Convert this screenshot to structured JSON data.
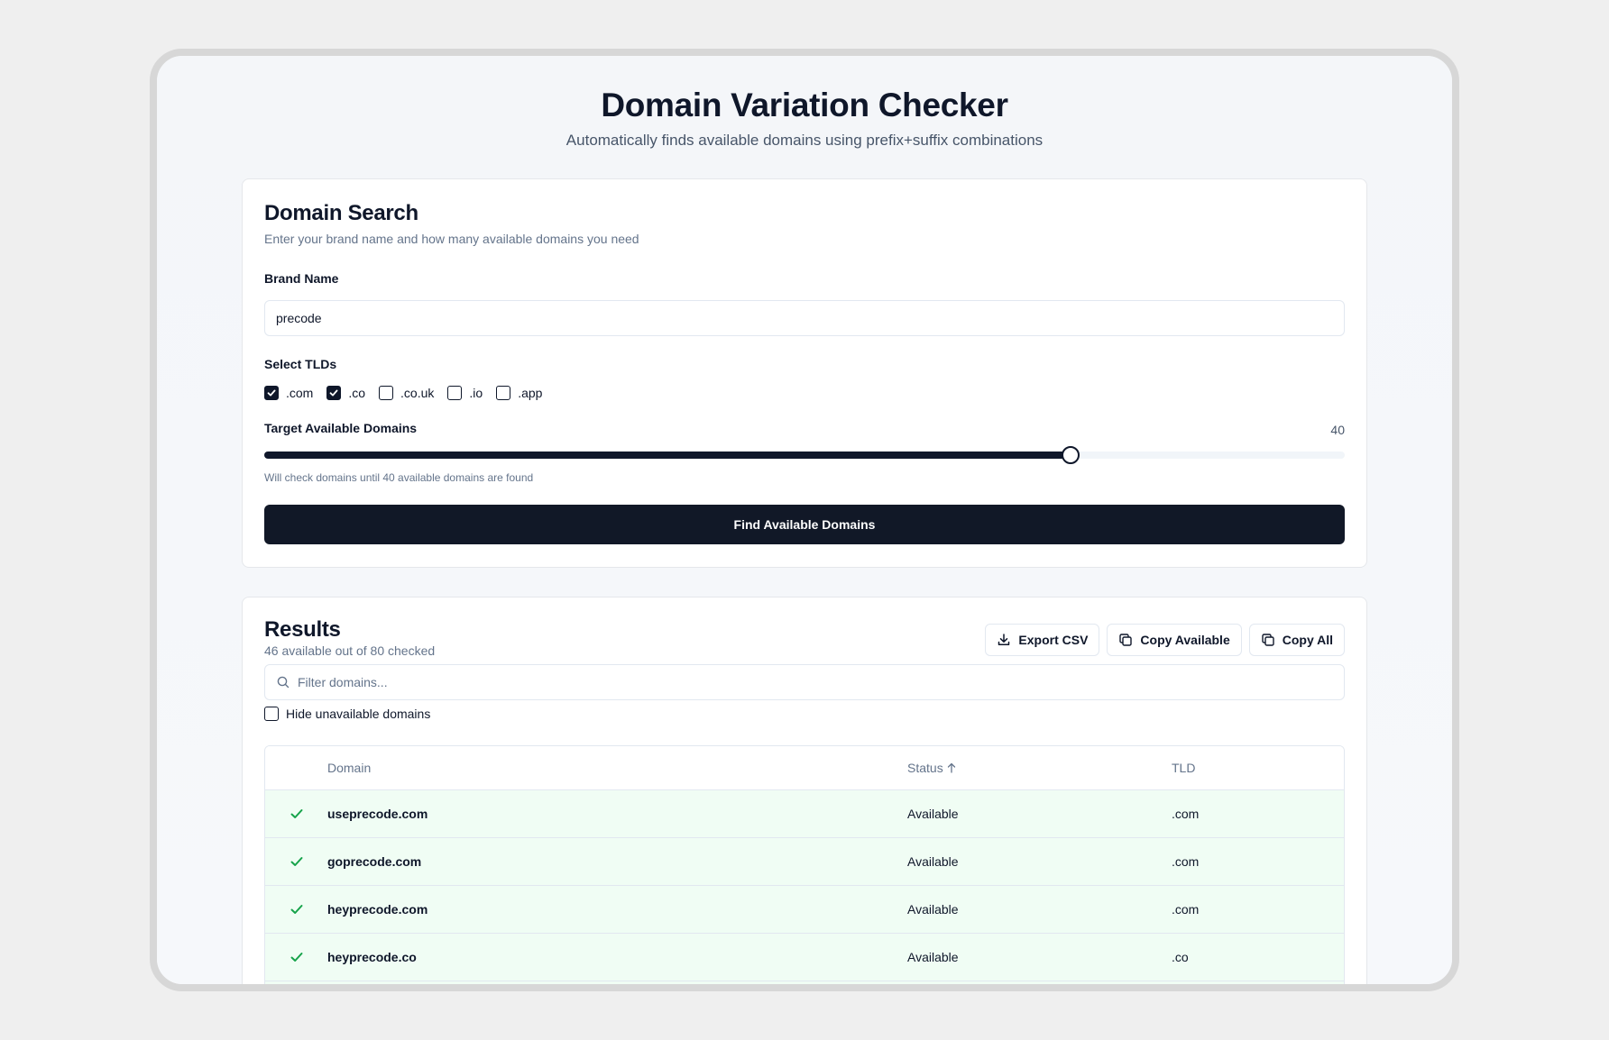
{
  "header": {
    "title": "Domain Variation Checker",
    "subtitle": "Automatically finds available domains using prefix+suffix combinations"
  },
  "search": {
    "title": "Domain Search",
    "description": "Enter your brand name and how many available domains you need",
    "brand_label": "Brand Name",
    "brand_value": "precode",
    "tlds_label": "Select TLDs",
    "tlds": [
      {
        "label": ".com",
        "checked": true
      },
      {
        "label": ".co",
        "checked": true
      },
      {
        "label": ".co.uk",
        "checked": false
      },
      {
        "label": ".io",
        "checked": false
      },
      {
        "label": ".app",
        "checked": false
      }
    ],
    "target_label": "Target Available Domains",
    "target_value": "40",
    "target_fraction": 0.746,
    "hint": "Will check domains until 40 available domains are found",
    "submit_label": "Find Available Domains"
  },
  "results": {
    "title": "Results",
    "summary": "46 available out of 80 checked",
    "export_label": "Export CSV",
    "copy_available_label": "Copy Available",
    "copy_all_label": "Copy All",
    "filter_placeholder": "Filter domains...",
    "hide_unavailable_label": "Hide unavailable domains",
    "columns": {
      "domain": "Domain",
      "status": "Status",
      "tld": "TLD"
    },
    "rows": [
      {
        "domain": "useprecode.com",
        "status": "Available",
        "tld": ".com"
      },
      {
        "domain": "goprecode.com",
        "status": "Available",
        "tld": ".com"
      },
      {
        "domain": "heyprecode.com",
        "status": "Available",
        "tld": ".com"
      },
      {
        "domain": "heyprecode.co",
        "status": "Available",
        "tld": ".co"
      }
    ]
  },
  "colors": {
    "primary": "#111827",
    "success": "#16a34a",
    "row_available_bg": "#f0fdf4"
  }
}
